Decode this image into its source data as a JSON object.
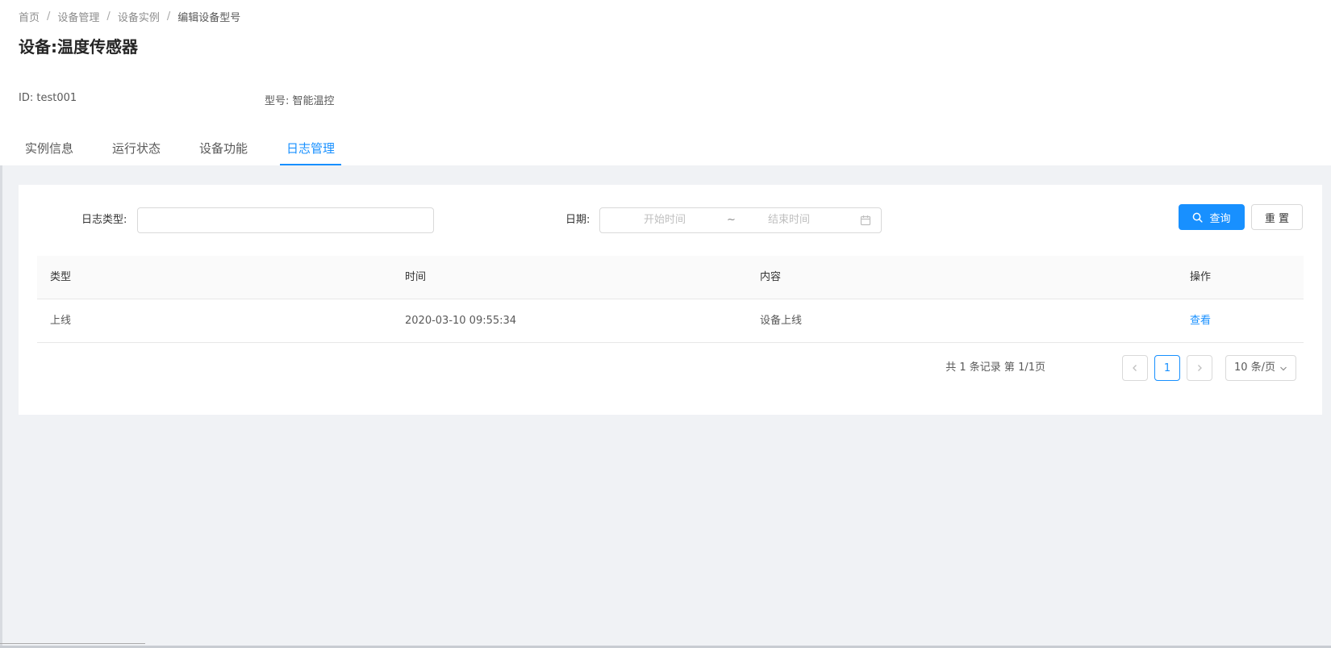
{
  "breadcrumb": {
    "items": [
      "首页",
      "设备管理",
      "设备实例",
      "编辑设备型号"
    ],
    "separator": "/"
  },
  "page": {
    "title": "设备:温度传感器"
  },
  "info": {
    "id_label": "ID:",
    "id_value": "test001",
    "model_label": "型号:",
    "model_value": "智能温控"
  },
  "tabs": [
    {
      "label": "实例信息",
      "active": false
    },
    {
      "label": "运行状态",
      "active": false
    },
    {
      "label": "设备功能",
      "active": false
    },
    {
      "label": "日志管理",
      "active": true
    }
  ],
  "filter": {
    "log_type_label": "日志类型:",
    "log_type_value": "",
    "date_label": "日期:",
    "start_placeholder": "开始时间",
    "range_separator": "~",
    "end_placeholder": "结束时间",
    "search_label": "查询",
    "reset_label": "重 置"
  },
  "table": {
    "columns": [
      "类型",
      "时间",
      "内容",
      "操作"
    ],
    "rows": [
      {
        "type": "上线",
        "time": "2020-03-10 09:55:34",
        "content": "设备上线",
        "action": "查看"
      }
    ]
  },
  "pagination": {
    "summary": "共 1 条记录 第 1/1页",
    "current_page": "1",
    "page_size": "10 条/页"
  },
  "colors": {
    "primary": "#1890ff",
    "background": "#f0f2f5"
  }
}
